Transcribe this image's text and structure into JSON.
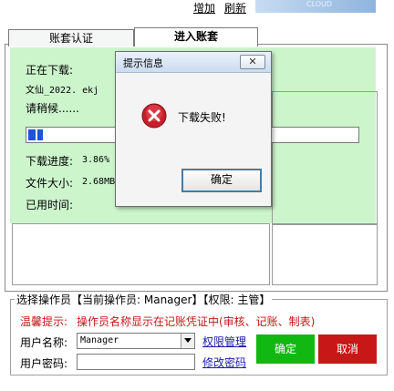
{
  "top_links": {
    "add": "增加",
    "refresh": "刷新"
  },
  "banner_text": "CLOUD",
  "tabs": [
    {
      "label": "账套认证"
    },
    {
      "label": "进入账套"
    }
  ],
  "download": {
    "downloading_label": "正在下载:",
    "filename": "文仙_2022. ekj",
    "wait_label": "请稍候......",
    "progress_label": "下载进度:",
    "progress_value": "3.86%",
    "progress_fraction": 0.0386,
    "size_label": "文件大小:",
    "size_value": "2.68MB",
    "elapsed_label": "已用时间:"
  },
  "dialog": {
    "title": "提示信息",
    "close": "✕",
    "message": "下载失败!",
    "ok": "确定"
  },
  "operator": {
    "legend": "选择操作员【当前操作员: Manager】【权限: 主管】",
    "warning_label": "温馨提示:",
    "warning_text": "操作员名称显示在记账凭证中(审核、记账、制表)",
    "username_label": "用户名称:",
    "username_value": "Manager",
    "password_label": "用户密码:",
    "perm_link": "权限管理",
    "pwd_link": "修改密码",
    "confirm": "确定",
    "cancel": "取消"
  }
}
